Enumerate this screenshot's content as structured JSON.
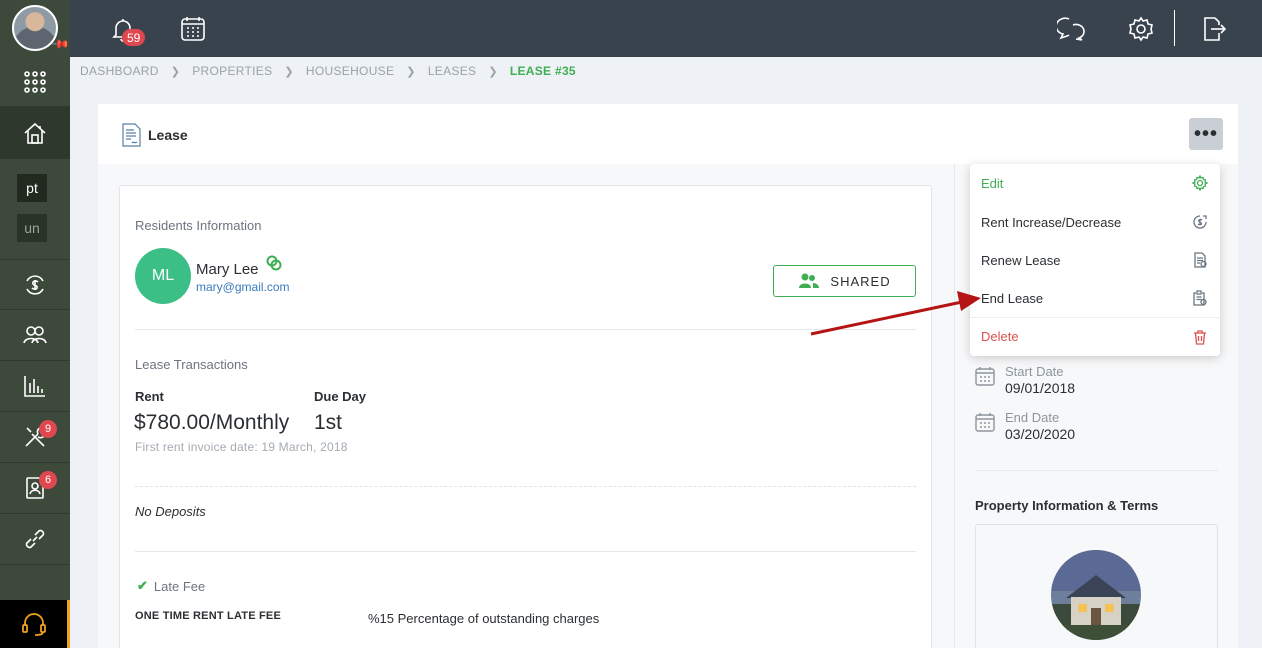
{
  "topbar": {
    "notification_count": "59"
  },
  "sidebar": {
    "pt_label": "pt",
    "un_label": "un",
    "tools_badge": "9",
    "tenants_badge": "6"
  },
  "breadcrumb": [
    "DASHBOARD",
    "PROPERTIES",
    "HOUSEHOUSE",
    "LEASES",
    "LEASE #35"
  ],
  "header": {
    "title": "Lease",
    "more_label": "•••"
  },
  "residents": {
    "section_title": "Residents Information",
    "initials": "ML",
    "name": "Mary Lee",
    "email": "mary@gmail.com",
    "shared_label": "SHARED"
  },
  "transactions": {
    "section_title": "Lease Transactions",
    "rent_label": "Rent",
    "rent_value": "$780.00/Monthly",
    "due_day_label": "Due Day",
    "due_day_value": "1st",
    "first_invoice_note": "First rent invoice date: 19 March, 2018",
    "deposits_note": "No Deposits",
    "late_fee_label": "Late Fee",
    "late_fee_name": "ONE TIME RENT LATE FEE",
    "late_fee_value": "%15 Percentage of outstanding charges"
  },
  "dates": {
    "start_label": "Start Date",
    "start_value": "09/01/2018",
    "end_label": "End Date",
    "end_value": "03/20/2020"
  },
  "property": {
    "title": "Property Information & Terms"
  },
  "menu": {
    "items": [
      {
        "label": "Edit",
        "icon": "gear-icon"
      },
      {
        "label": "Rent Increase/Decrease",
        "icon": "dollar-clock-icon"
      },
      {
        "label": "Renew Lease",
        "icon": "document-renew-icon"
      },
      {
        "label": "End Lease",
        "icon": "document-end-icon"
      },
      {
        "label": "Delete",
        "icon": "trash-icon"
      }
    ]
  },
  "colors": {
    "accent": "#3fae54",
    "danger": "#d9534f",
    "topbar": "#39434d",
    "sidebar": "#3d4a3b",
    "arrow": "#b51414"
  }
}
